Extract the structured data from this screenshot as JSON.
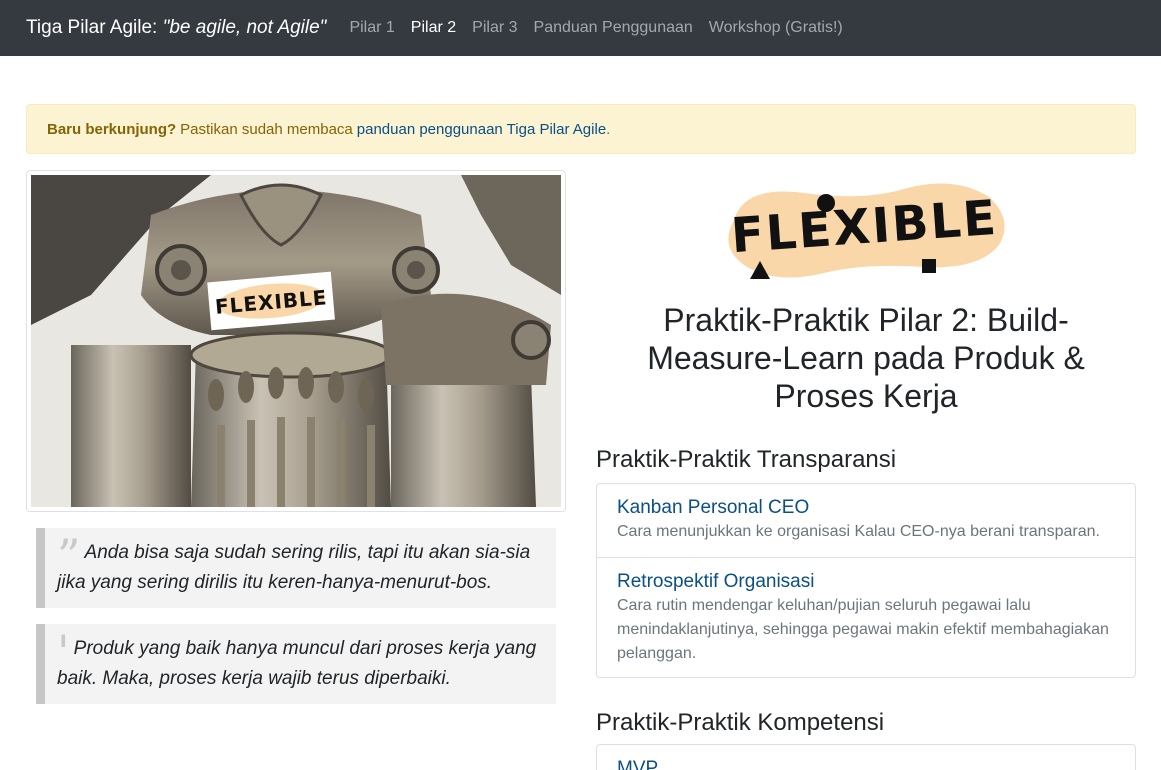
{
  "navbar": {
    "brand_prefix": "Tiga Pilar Agile:",
    "brand_tagline": "\"be agile, not Agile\"",
    "links": [
      {
        "label": "Pilar 1"
      },
      {
        "label": "Pilar 2"
      },
      {
        "label": "Pilar 3"
      },
      {
        "label": "Panduan Penggunaan"
      },
      {
        "label": "Workshop (Gratis!)"
      }
    ],
    "active_index": 1
  },
  "alert": {
    "bold": "Baru berkunjung?",
    "text": "Pastikan sudah membaca",
    "link": "panduan penggunaan Tiga Pilar Agile",
    "end": "."
  },
  "photo": {
    "label_text": "FLEXIBLE"
  },
  "quotes": [
    {
      "mark": "”",
      "text": "Anda bisa saja sudah sering rilis, tapi itu akan sia-sia jika yang sering dirilis itu keren-hanya-menurut-bos."
    },
    {
      "mark": "'",
      "text": "Produk yang baik hanya muncul dari proses kerja yang baik. Maka, proses kerja wajib terus diperbaiki."
    }
  ],
  "logo": {
    "text": "FLEXIBLE"
  },
  "main_title": "Praktik-Praktik Pilar 2: Build-Measure-Learn pada Produk & Proses Kerja",
  "sections": [
    {
      "title": "Praktik-Praktik Transparansi",
      "items": [
        {
          "title": "Kanban Personal CEO",
          "desc": "Cara menunjukkan ke organisasi Kalau CEO-nya berani transparan."
        },
        {
          "title": "Retrospektif Organisasi",
          "desc": "Cara rutin mendengar keluhan/pujian seluruh pegawai lalu menindaklanjutinya, sehingga pegawai makin efektif membahagiakan pelanggan."
        }
      ]
    },
    {
      "title": "Praktik-Praktik Kompetensi",
      "items": [
        {
          "title": "MVP",
          "desc": ""
        }
      ]
    }
  ],
  "colors": {
    "navbar_bg": "#343a40",
    "alert_bg": "#fcf3d2",
    "link": "#0a4f86",
    "logo_blob": "#f9d7a8"
  }
}
